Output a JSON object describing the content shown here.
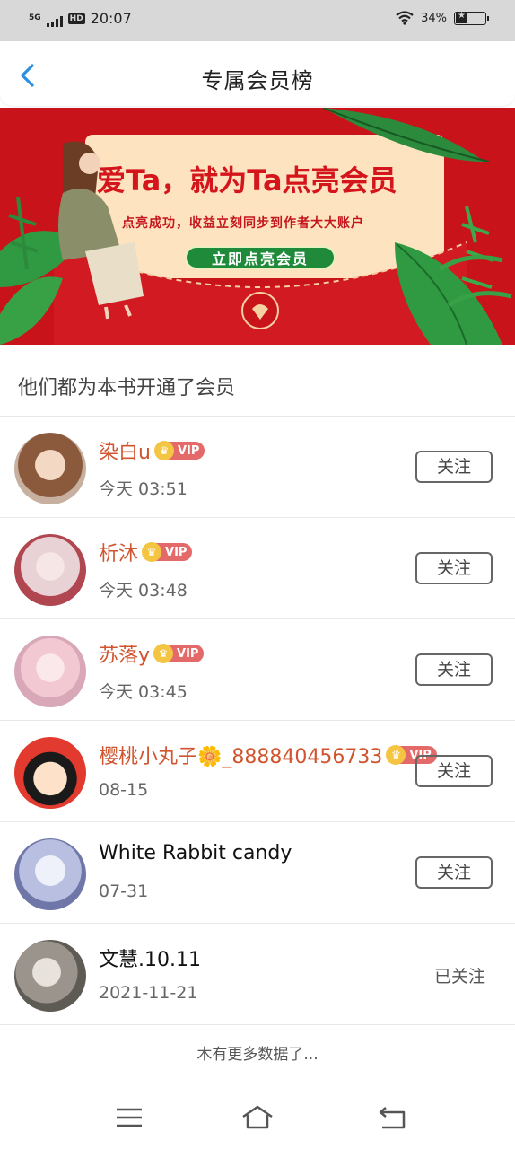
{
  "status_bar": {
    "network": "5G",
    "hd": "HD",
    "time": "20:07",
    "battery": "34%"
  },
  "nav": {
    "title": "专属会员榜",
    "back_icon": "chevron-left-icon"
  },
  "banner": {
    "title": "爱Ta，就为Ta点亮会员",
    "subtitle": "点亮成功，收益立刻同步到作者大大账户",
    "button_label": "立即点亮会员"
  },
  "section_header": "他们都为本书开通了会员",
  "vip_label": "VIP",
  "colors": {
    "vip_name": "#d0552f",
    "plain_name": "#111111",
    "banner_red": "#c8131a",
    "accent_blue": "#2c8fe0"
  },
  "members": [
    {
      "name": "染白u",
      "vip": true,
      "time": "今天 03:51",
      "action": "关注",
      "followed": false
    },
    {
      "name": "析沐",
      "vip": true,
      "time": "今天 03:48",
      "action": "关注",
      "followed": false
    },
    {
      "name": "苏落y",
      "vip": true,
      "time": "今天 03:45",
      "action": "关注",
      "followed": false
    },
    {
      "name": "樱桃小丸子🌼_888840456733",
      "vip": true,
      "time": "08-15",
      "action": "关注",
      "followed": false
    },
    {
      "name": "White Rabbit candy",
      "vip": false,
      "time": "07-31",
      "action": "关注",
      "followed": false
    },
    {
      "name": "文慧.10.11",
      "vip": false,
      "time": "2021-11-21",
      "action": "已关注",
      "followed": true
    }
  ],
  "footer_text": "木有更多数据了...",
  "system_nav": [
    "menu-icon",
    "home-icon",
    "back-icon"
  ]
}
